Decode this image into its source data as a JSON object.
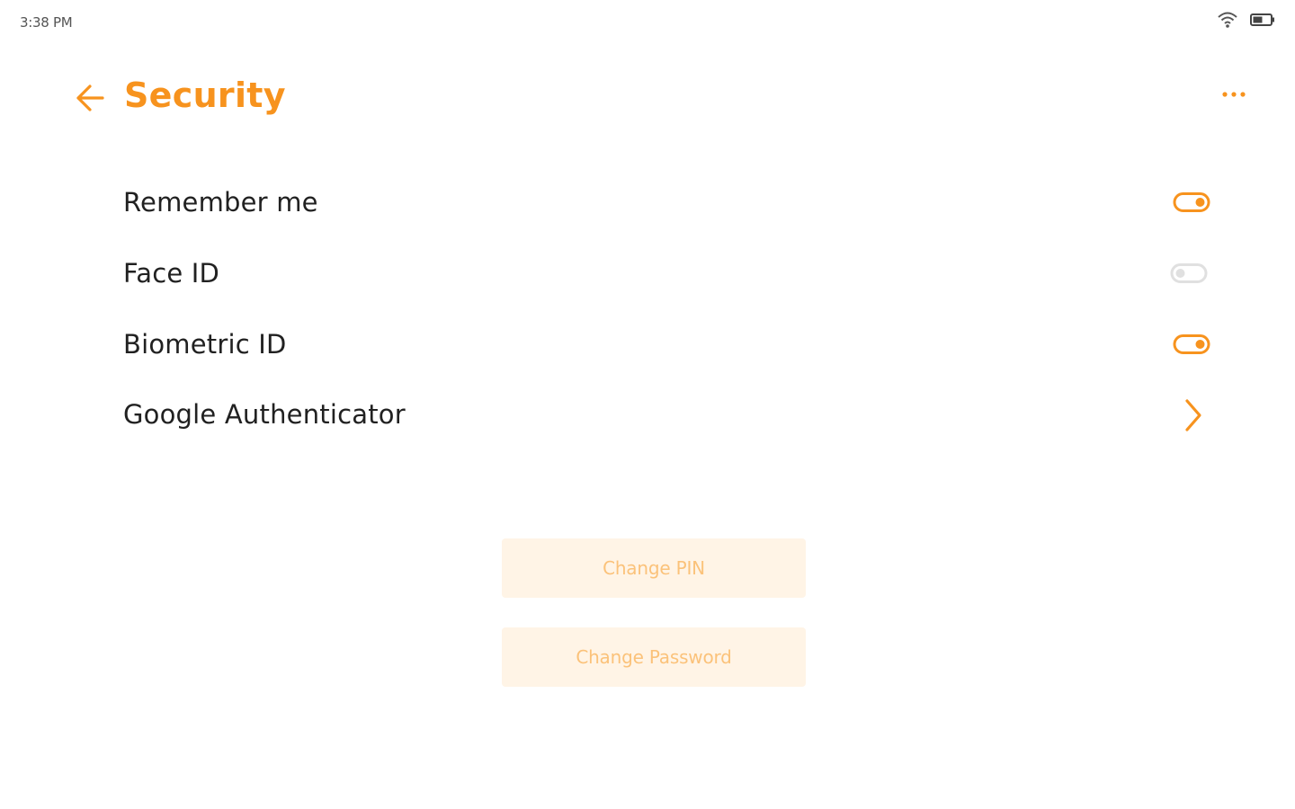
{
  "status_bar": {
    "time": "3:38 PM",
    "icons": [
      "wifi-icon",
      "battery-icon"
    ]
  },
  "header": {
    "title": "Security",
    "back_icon": "arrow-left-icon",
    "menu_icon": "more-horizontal-icon"
  },
  "settings": [
    {
      "label": "Remember me",
      "control": "toggle",
      "on": true
    },
    {
      "label": "Face ID",
      "control": "toggle",
      "on": false
    },
    {
      "label": "Biometric ID",
      "control": "toggle",
      "on": true
    },
    {
      "label": "Google Authenticator",
      "control": "chevron-right-icon"
    }
  ],
  "actions": {
    "change_pin": "Change PIN",
    "change_password": "Change Password"
  },
  "colors": {
    "accent": "#F7931E",
    "toggle_off": "#E0E0E0",
    "button_bg": "#FFF4E6",
    "button_text": "#FBC27A"
  }
}
